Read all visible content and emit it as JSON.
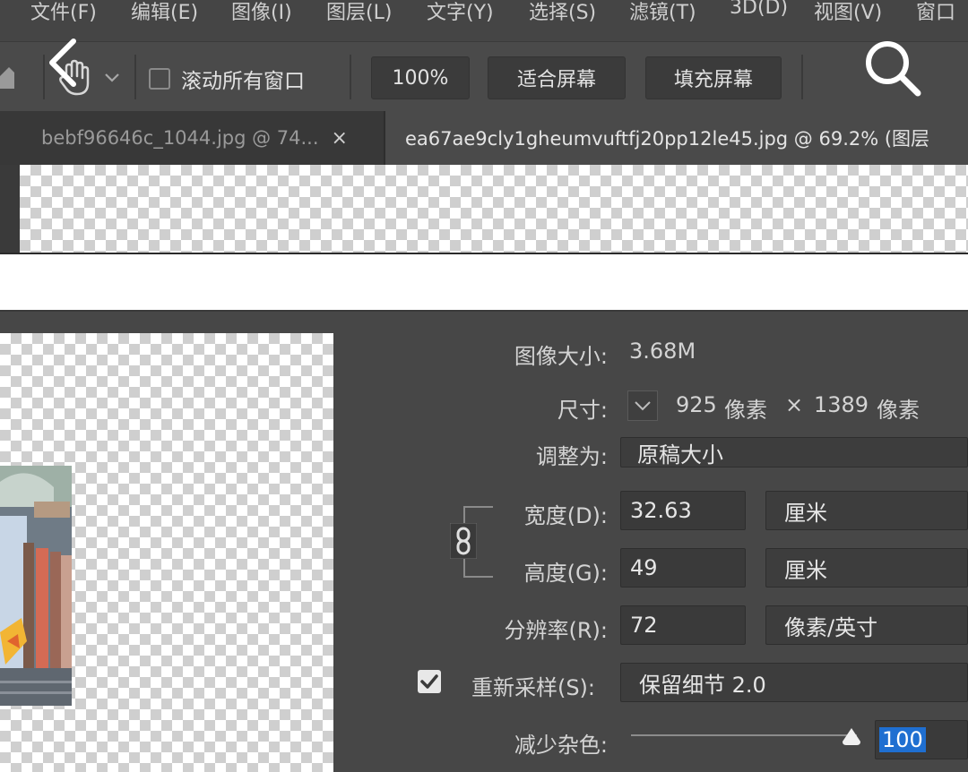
{
  "menubar": {
    "items": [
      "文件(F)",
      "编辑(E)",
      "图像(I)",
      "图层(L)",
      "文字(Y)",
      "选择(S)",
      "滤镜(T)",
      "3D(D)",
      "视图(V)",
      "窗口"
    ]
  },
  "options_bar": {
    "scroll_all_windows_label": "滚动所有窗口",
    "scroll_all_windows_checked": false,
    "zoom_button": "100%",
    "fit_screen_button": "适合屏幕",
    "fill_screen_button": "填充屏幕"
  },
  "tabs": [
    {
      "label": "bebf96646c_1044.jpg @ 74...",
      "close": "×",
      "active": false
    },
    {
      "label": "ea67ae9cly1gheumvuftfj20pp12le45.jpg @ 69.2% (图层",
      "active": true
    }
  ],
  "image_size_dialog": {
    "image_size_label": "图像大小:",
    "image_size_value": "3.68M",
    "dimensions_label": "尺寸:",
    "dimensions_width": "925",
    "dimensions_unit1": "像素",
    "dimensions_times": "×",
    "dimensions_height": "1389",
    "dimensions_unit2": "像素",
    "fit_to_label": "调整为:",
    "fit_to_value": "原稿大小",
    "width_label": "宽度(D):",
    "width_value": "32.63",
    "width_unit": "厘米",
    "height_label": "高度(G):",
    "height_value": "49",
    "height_unit": "厘米",
    "resolution_label": "分辨率(R):",
    "resolution_value": "72",
    "resolution_unit": "像素/英寸",
    "resample_checked": true,
    "resample_label": "重新采样(S):",
    "resample_value": "保留细节 2.0",
    "reduce_noise_label": "减少杂色:",
    "reduce_noise_value": "100",
    "reduce_noise_level": 1.0
  },
  "colors": {
    "panel": "#474747",
    "field": "#3a3a3a",
    "highlight": "#1f6fd1"
  }
}
